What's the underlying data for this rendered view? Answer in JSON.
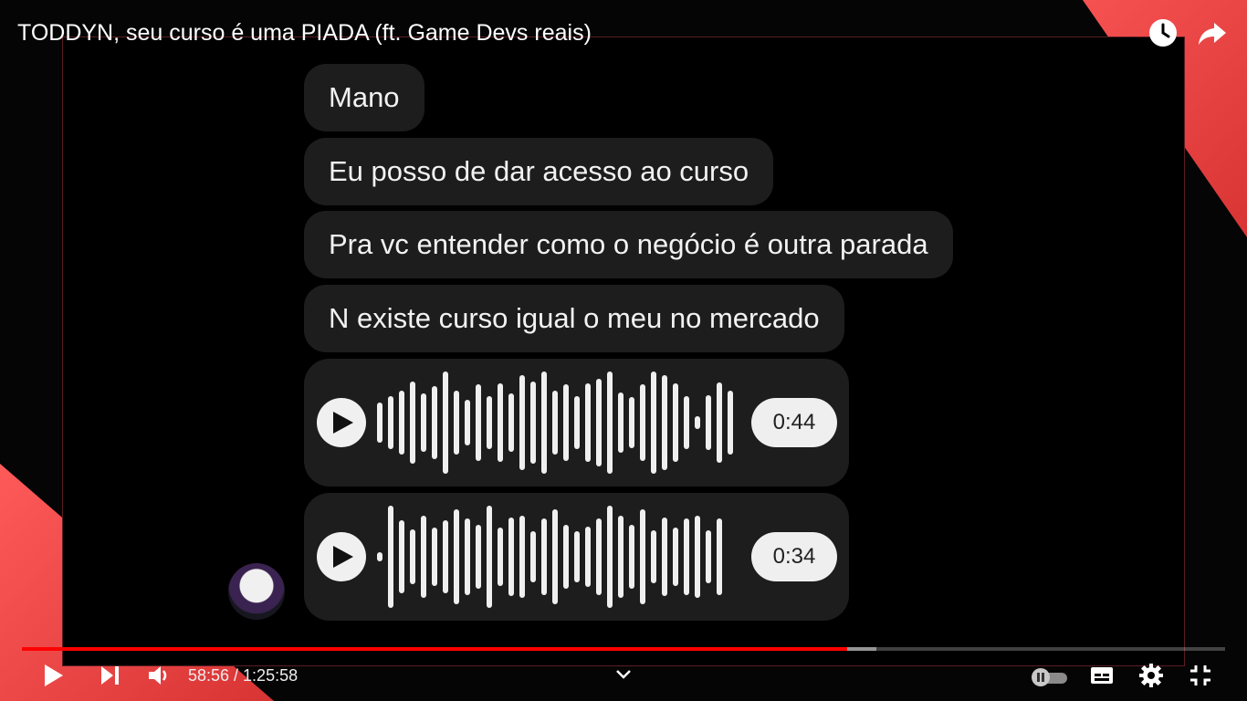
{
  "video": {
    "title": "TODDYN, seu curso é uma PIADA (ft. Game Devs reais)",
    "accent_color": "#ff0000",
    "watch_later_icon": "clock-icon",
    "share_icon": "share-arrow-icon"
  },
  "chat": {
    "messages": [
      {
        "text": "Mano"
      },
      {
        "text": "Eu posso de dar acesso ao curso"
      },
      {
        "text": "Pra vc entender como o negócio é outra parada"
      },
      {
        "text": "N existe curso igual o meu no mercado"
      }
    ],
    "voice_notes": [
      {
        "duration": "0:44",
        "icon": "play-icon"
      },
      {
        "duration": "0:34",
        "icon": "play-icon"
      }
    ],
    "avatar_icon": "avatar"
  },
  "player": {
    "progress_played": 0.686,
    "progress_buffered": 0.71,
    "time_display": "58:56 / 1:25:58",
    "controls": {
      "play": "play-icon",
      "next": "skip-next-icon",
      "volume": "volume-icon",
      "chapters": "chevron-down-icon",
      "autoplay": "autoplay-toggle-icon",
      "subtitles": "subtitles-icon",
      "settings": "gear-icon",
      "exit_fullscreen": "exit-fullscreen-icon"
    }
  }
}
